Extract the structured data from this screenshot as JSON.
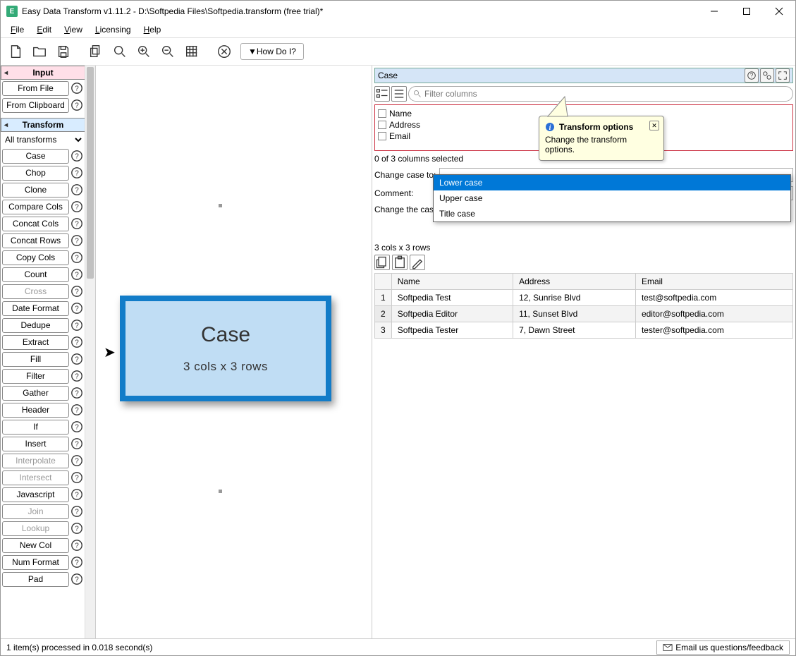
{
  "window": {
    "title": "Easy Data Transform v1.11.2 - D:\\Softpedia Files\\Softpedia.transform (free trial)*"
  },
  "menu": [
    "File",
    "Edit",
    "View",
    "Licensing",
    "Help"
  ],
  "toolbar": {
    "howdoi": "▼How Do I?"
  },
  "left": {
    "input_header": "Input",
    "from_file": "From File",
    "from_clipboard": "From Clipboard",
    "transform_header": "Transform",
    "filter_dropdown": "All transforms",
    "transforms": [
      {
        "label": "Case",
        "disabled": false
      },
      {
        "label": "Chop",
        "disabled": false
      },
      {
        "label": "Clone",
        "disabled": false
      },
      {
        "label": "Compare Cols",
        "disabled": false
      },
      {
        "label": "Concat Cols",
        "disabled": false
      },
      {
        "label": "Concat Rows",
        "disabled": false
      },
      {
        "label": "Copy Cols",
        "disabled": false
      },
      {
        "label": "Count",
        "disabled": false
      },
      {
        "label": "Cross",
        "disabled": true
      },
      {
        "label": "Date Format",
        "disabled": false
      },
      {
        "label": "Dedupe",
        "disabled": false
      },
      {
        "label": "Extract",
        "disabled": false
      },
      {
        "label": "Fill",
        "disabled": false
      },
      {
        "label": "Filter",
        "disabled": false
      },
      {
        "label": "Gather",
        "disabled": false
      },
      {
        "label": "Header",
        "disabled": false
      },
      {
        "label": "If",
        "disabled": false
      },
      {
        "label": "Insert",
        "disabled": false
      },
      {
        "label": "Interpolate",
        "disabled": true
      },
      {
        "label": "Intersect",
        "disabled": true
      },
      {
        "label": "Javascript",
        "disabled": false
      },
      {
        "label": "Join",
        "disabled": true
      },
      {
        "label": "Lookup",
        "disabled": true
      },
      {
        "label": "New Col",
        "disabled": false
      },
      {
        "label": "Num Format",
        "disabled": false
      },
      {
        "label": "Pad",
        "disabled": false
      }
    ]
  },
  "node": {
    "title": "Case",
    "sub": "3 cols x 3 rows"
  },
  "rp": {
    "header_title": "Case",
    "filter_placeholder": "Filter columns",
    "columns": [
      "Name",
      "Address",
      "Email"
    ],
    "selected_text": "0 of 3 columns selected",
    "change_case_label": "Change case to:",
    "comment_label": "Comment:",
    "description": "Change the case",
    "dropdown_options": [
      "Lower case",
      "Upper case",
      "Title case"
    ],
    "preview_meta": "3 cols x 3 rows",
    "table": {
      "headers": [
        "Name",
        "Address",
        "Email"
      ],
      "rows": [
        [
          "Softpedia Test",
          "12, Sunrise Blvd",
          "test@softpedia.com"
        ],
        [
          "Softpedia Editor",
          "11, Sunset Blvd",
          "editor@softpedia.com"
        ],
        [
          "Softpedia Tester",
          "7, Dawn Street",
          "tester@softpedia.com"
        ]
      ]
    }
  },
  "tooltip": {
    "title": "Transform options",
    "body": "Change the transform options."
  },
  "status": {
    "text": "1 item(s) processed in 0.018 second(s)",
    "feedback": "Email us questions/feedback"
  }
}
